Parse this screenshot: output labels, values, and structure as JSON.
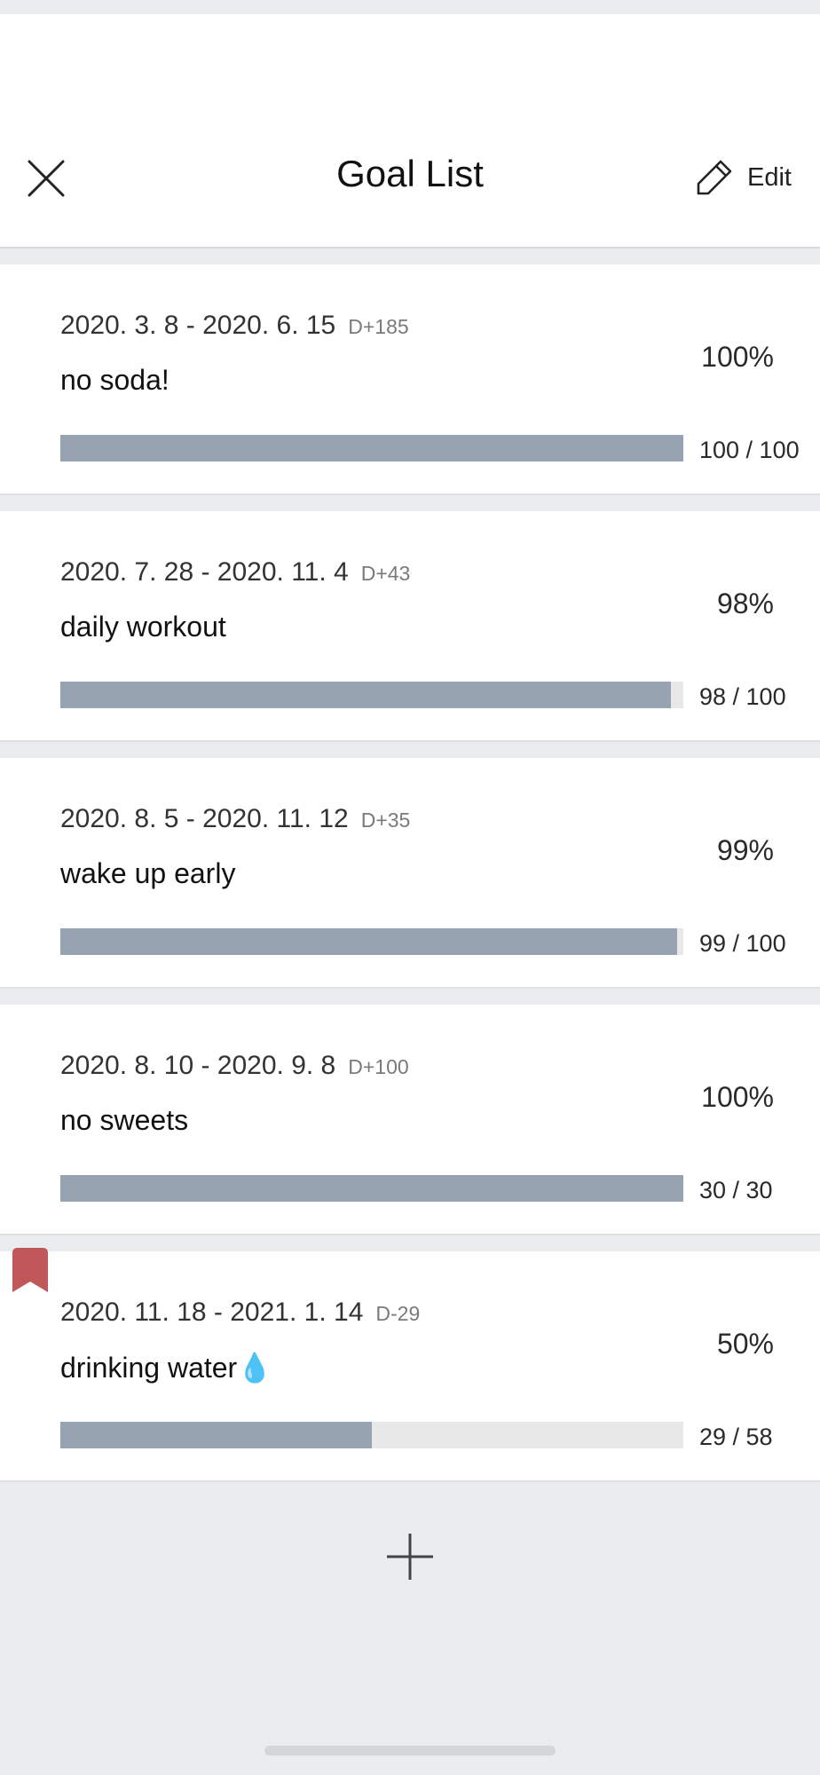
{
  "header": {
    "title": "Goal List",
    "edit_label": "Edit",
    "close_icon": "close-icon",
    "edit_icon": "pencil-icon"
  },
  "goals": [
    {
      "dates": "2020. 3. 8 - 2020. 6. 15",
      "dday": "D+185",
      "name": "no soda!",
      "percent": "100%",
      "count": "100 / 100",
      "progress": 1.0,
      "bookmarked": false
    },
    {
      "dates": "2020. 7. 28 - 2020. 11. 4",
      "dday": "D+43",
      "name": "daily workout",
      "percent": "98%",
      "count": "98 / 100",
      "progress": 0.98,
      "bookmarked": false
    },
    {
      "dates": "2020. 8. 5 - 2020. 11. 12",
      "dday": "D+35",
      "name": "wake up early",
      "percent": "99%",
      "count": "99 / 100",
      "progress": 0.99,
      "bookmarked": false
    },
    {
      "dates": "2020. 8. 10 - 2020. 9. 8",
      "dday": "D+100",
      "name": "no sweets",
      "percent": "100%",
      "count": "30 / 30",
      "progress": 1.0,
      "bookmarked": false
    },
    {
      "dates": "2020. 11. 18 - 2021. 1. 14",
      "dday": "D-29",
      "name": "drinking water💧",
      "percent": "50%",
      "count": "29 / 58",
      "progress": 0.5,
      "bookmarked": true
    }
  ],
  "colors": {
    "background": "#ebecef",
    "card": "#ffffff",
    "bar_fill": "#98a3b2",
    "bar_track": "#e8e8e8",
    "bookmark": "#c0585a"
  },
  "add_icon": "plus-icon"
}
